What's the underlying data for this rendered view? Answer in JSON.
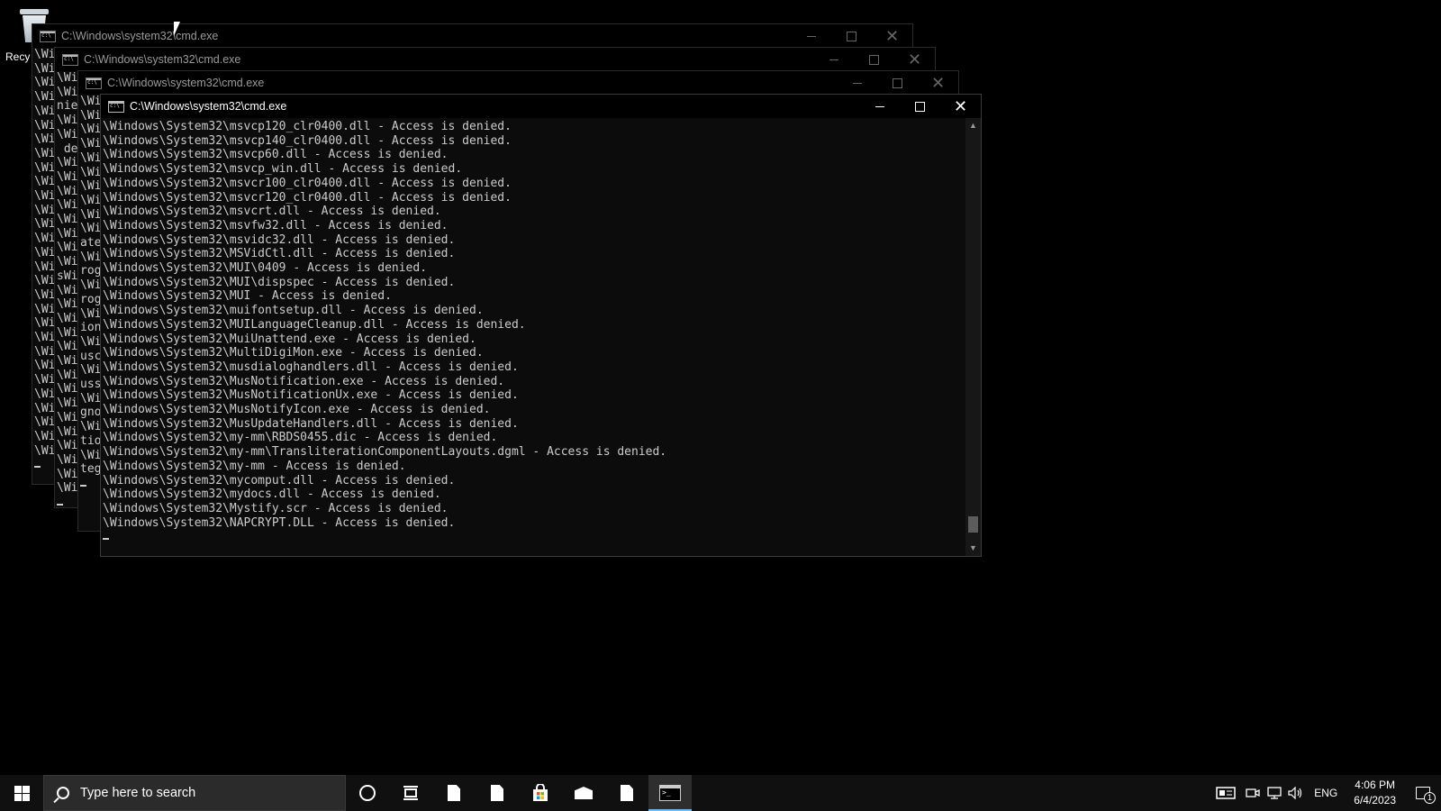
{
  "desktop": {
    "recycle_bin_label": "Recy"
  },
  "windows": [
    {
      "title": "C:\\Windows\\system32\\cmd.exe",
      "state": "inactive",
      "lines": [
        "\\Wi",
        "\\Wi",
        "\\Wi",
        "\\Wi",
        "\\Wi",
        "\\Wi",
        "\\Wi",
        "\\Wi",
        "\\Wi",
        "\\Wi",
        "\\Wi",
        "\\Wi",
        "\\Wi",
        "\\Wi",
        "\\Wi",
        "\\Wi",
        "\\Wi",
        "\\Wi",
        "\\Wi",
        "\\Wi",
        "\\Wi",
        "\\Wi",
        "\\Wi",
        "\\Wi",
        "\\Wi",
        "\\Wi",
        "\\Wi",
        "\\Wi",
        "\\Wi"
      ]
    },
    {
      "title": "C:\\Windows\\system32\\cmd.exe",
      "state": "inactive",
      "lines": [
        "\\Wi",
        "\\Wi",
        "nie",
        "\\Wi",
        "\\Wi",
        " de",
        "\\Wi",
        "\\Wi",
        "\\Wi",
        "\\Wi",
        "\\Wi",
        "\\Wi",
        "\\Wi",
        "\\Wi",
        "sWi",
        "\\Wi",
        "\\Wi",
        "\\Wi",
        "\\Wi",
        "\\Wi",
        "\\Wi",
        "\\Wi",
        "\\Wi",
        "\\Wi",
        "\\Wi",
        "\\Wi",
        "\\Wi",
        "\\Wi",
        "\\Wi",
        "\\Wi"
      ]
    },
    {
      "title": "C:\\Windows\\system32\\cmd.exe",
      "state": "inactive",
      "lines": [
        "\\Wi",
        "\\Wi",
        "\\Wi",
        "\\Wi",
        "\\Wi",
        "\\Wi",
        "\\Wi",
        "\\Wi",
        "\\Wi",
        "\\Wi",
        "ate",
        "\\Wi",
        "rog",
        "\\Wi",
        "rog",
        "\\Wi",
        "ion",
        "\\Wi",
        "usc",
        "\\Wi",
        "uss",
        "\\Wi",
        "gno",
        "\\Wi",
        "tio",
        "\\Wi",
        "teg"
      ]
    },
    {
      "title": "C:\\Windows\\system32\\cmd.exe",
      "state": "active",
      "lines": [
        "\\Windows\\System32\\msvcp120_clr0400.dll - Access is denied.",
        "\\Windows\\System32\\msvcp140_clr0400.dll - Access is denied.",
        "\\Windows\\System32\\msvcp60.dll - Access is denied.",
        "\\Windows\\System32\\msvcp_win.dll - Access is denied.",
        "\\Windows\\System32\\msvcr100_clr0400.dll - Access is denied.",
        "\\Windows\\System32\\msvcr120_clr0400.dll - Access is denied.",
        "\\Windows\\System32\\msvcrt.dll - Access is denied.",
        "\\Windows\\System32\\msvfw32.dll - Access is denied.",
        "\\Windows\\System32\\msvidc32.dll - Access is denied.",
        "\\Windows\\System32\\MSVidCtl.dll - Access is denied.",
        "\\Windows\\System32\\MUI\\0409 - Access is denied.",
        "\\Windows\\System32\\MUI\\dispspec - Access is denied.",
        "\\Windows\\System32\\MUI - Access is denied.",
        "\\Windows\\System32\\muifontsetup.dll - Access is denied.",
        "\\Windows\\System32\\MUILanguageCleanup.dll - Access is denied.",
        "\\Windows\\System32\\MuiUnattend.exe - Access is denied.",
        "\\Windows\\System32\\MultiDigiMon.exe - Access is denied.",
        "\\Windows\\System32\\musdialoghandlers.dll - Access is denied.",
        "\\Windows\\System32\\MusNotification.exe - Access is denied.",
        "\\Windows\\System32\\MusNotificationUx.exe - Access is denied.",
        "\\Windows\\System32\\MusNotifyIcon.exe - Access is denied.",
        "\\Windows\\System32\\MusUpdateHandlers.dll - Access is denied.",
        "\\Windows\\System32\\my-mm\\RBDS0455.dic - Access is denied.",
        "\\Windows\\System32\\my-mm\\TransliterationComponentLayouts.dgml - Access is denied.",
        "\\Windows\\System32\\my-mm - Access is denied.",
        "\\Windows\\System32\\mycomput.dll - Access is denied.",
        "\\Windows\\System32\\mydocs.dll - Access is denied.",
        "\\Windows\\System32\\Mystify.scr - Access is denied.",
        "\\Windows\\System32\\NAPCRYPT.DLL - Access is denied."
      ]
    }
  ],
  "taskbar": {
    "search_placeholder": "Type here to search",
    "pinned": [
      "cortana-icon",
      "task-view-icon",
      "file-icon",
      "file-icon",
      "store-icon",
      "mail-icon",
      "file-icon",
      "cmd-icon"
    ],
    "language": "ENG",
    "time": "4:06 PM",
    "date": "6/4/2023",
    "notification_count": "1"
  },
  "colors": {
    "console_bg": "#0c0c0c",
    "console_text": "#cccccc",
    "taskbar_bg": "#101010",
    "active_indicator": "#76b9ed"
  }
}
